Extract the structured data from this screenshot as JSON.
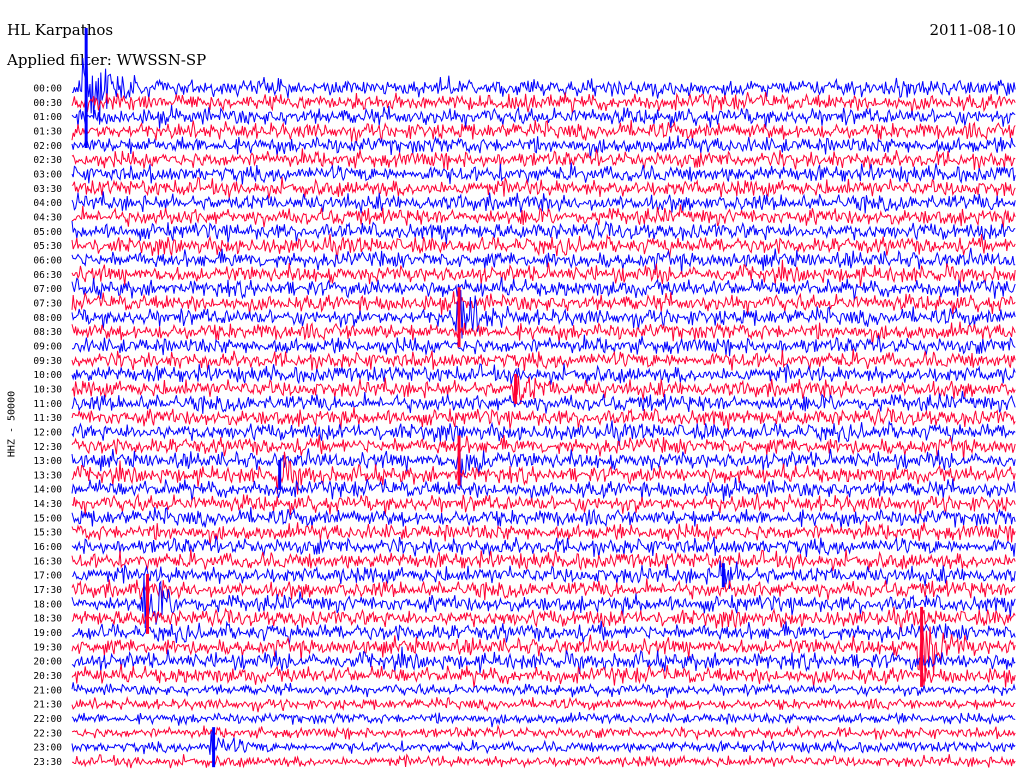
{
  "header": {
    "station": "HL Karpathos",
    "filter": "Applied filter: WWSSN-SP",
    "date": "2011-08-10"
  },
  "chart_data": {
    "type": "line",
    "title": "HL Karpathos",
    "subtitle": "Applied filter: WWSSN-SP",
    "date": "2011-08-10",
    "ylabel": "HHZ - 50000",
    "row_labels": [
      "00:00",
      "00:30",
      "01:00",
      "01:30",
      "02:00",
      "02:30",
      "03:00",
      "03:30",
      "04:00",
      "04:30",
      "05:00",
      "05:30",
      "06:00",
      "06:30",
      "07:00",
      "07:30",
      "08:00",
      "08:30",
      "09:00",
      "09:30",
      "10:00",
      "10:30",
      "11:00",
      "11:30",
      "12:00",
      "12:30",
      "13:00",
      "13:30",
      "14:00",
      "14:30",
      "15:00",
      "15:30",
      "16:00",
      "16:30",
      "17:00",
      "17:30",
      "18:00",
      "18:30",
      "19:00",
      "19:30",
      "20:00",
      "20:30",
      "21:00",
      "21:30",
      "22:00",
      "22:30",
      "23:00",
      "23:30"
    ],
    "row_duration_minutes": 30,
    "series_colors": [
      "#0000ff",
      "#ff0033"
    ],
    "events": [
      {
        "row": "00:00",
        "position": 0.015,
        "amplitude": 6,
        "color": "#0000ff"
      },
      {
        "row": "08:00",
        "position": 0.41,
        "amplitude": 3,
        "color": "#ff0033"
      },
      {
        "row": "13:00",
        "position": 0.41,
        "amplitude": 2.5,
        "color": "#ff0033"
      },
      {
        "row": "10:30",
        "position": 0.47,
        "amplitude": 1.5,
        "color": "#ff0033"
      },
      {
        "row": "13:30",
        "position": 0.22,
        "amplitude": 1.5,
        "color": "#0000ff"
      },
      {
        "row": "18:00",
        "position": 0.08,
        "amplitude": 3,
        "color": "#ff0033"
      },
      {
        "row": "19:30",
        "position": 0.9,
        "amplitude": 4,
        "color": "#ff0033"
      },
      {
        "row": "17:00",
        "position": 0.69,
        "amplitude": 1.2,
        "color": "#0000ff"
      },
      {
        "row": "23:00",
        "position": 0.15,
        "amplitude": 2,
        "color": "#0000ff"
      }
    ]
  }
}
